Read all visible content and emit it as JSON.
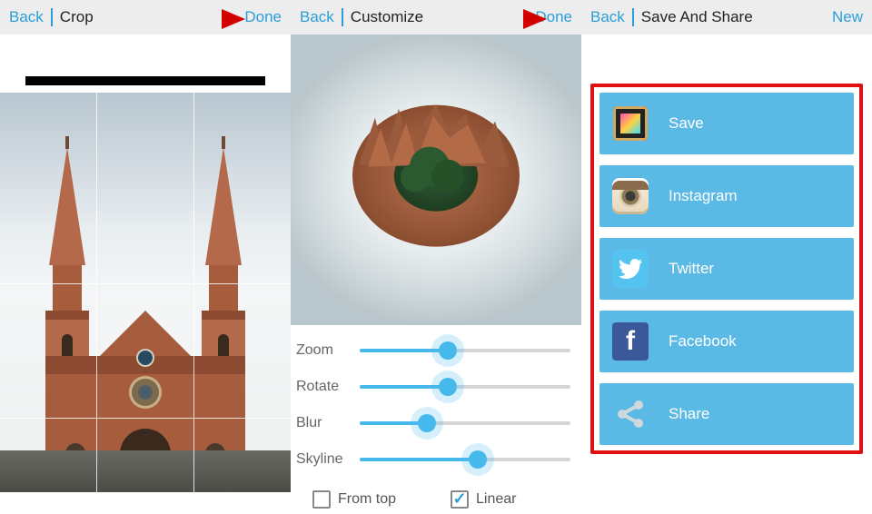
{
  "panel1": {
    "back": "Back",
    "title": "Crop",
    "done": "Done"
  },
  "panel2": {
    "back": "Back",
    "title": "Customize",
    "done": "Done",
    "sliders": {
      "zoom": {
        "label": "Zoom",
        "value": 42
      },
      "rotate": {
        "label": "Rotate",
        "value": 42
      },
      "blur": {
        "label": "Blur",
        "value": 32
      },
      "skyline": {
        "label": "Skyline",
        "value": 56
      }
    },
    "checks": {
      "from_top": {
        "label": "From top",
        "checked": false
      },
      "linear": {
        "label": "Linear",
        "checked": true
      }
    }
  },
  "panel3": {
    "back": "Back",
    "title": "Save And Share",
    "new": "New",
    "buttons": {
      "save": "Save",
      "instagram": "Instagram",
      "twitter": "Twitter",
      "facebook": "Facebook",
      "share": "Share"
    }
  }
}
